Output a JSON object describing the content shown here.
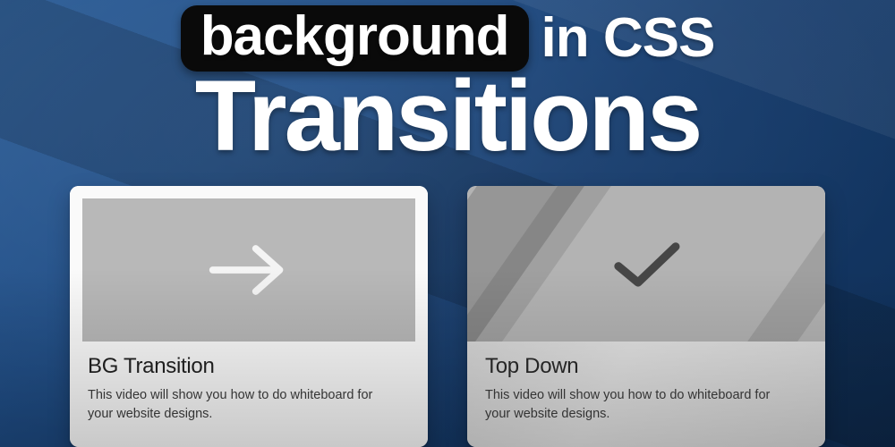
{
  "title": {
    "chip": "background",
    "rest_of_line1": "in CSS",
    "line2": "Transitions"
  },
  "cards": [
    {
      "icon": "arrow-right-icon",
      "heading": "BG Transition",
      "description": "This video will show you how to do whiteboard for your website designs."
    },
    {
      "icon": "checkmark-icon",
      "heading": "Top Down",
      "description": "This video will show you how to do whiteboard for your website designs."
    }
  ],
  "colors": {
    "chip_bg": "#0a0a0a",
    "page_gradient_start": "#2b5c96",
    "page_gradient_end": "#0f2f57"
  }
}
